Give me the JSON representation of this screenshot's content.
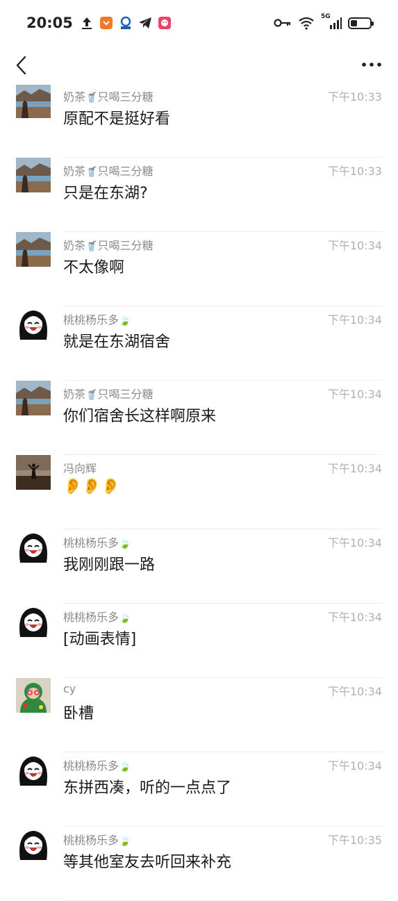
{
  "status": {
    "time": "20:05",
    "network": "5G"
  },
  "battery_level": 0.35,
  "messages": [
    {
      "sender": "奶茶",
      "sender_suffix": "只喝三分糖",
      "suffix_emoji": "🥤",
      "time": "下午10:33",
      "text": "原配不是挺好看",
      "avatar": "landscape"
    },
    {
      "sender": "奶茶",
      "sender_suffix": "只喝三分糖",
      "suffix_emoji": "🥤",
      "time": "下午10:33",
      "text": "只是在东湖?",
      "avatar": "landscape"
    },
    {
      "sender": "奶茶",
      "sender_suffix": "只喝三分糖",
      "suffix_emoji": "🥤",
      "time": "下午10:34",
      "text": "不太像啊",
      "avatar": "landscape"
    },
    {
      "sender": "桃桃杨乐多",
      "sender_suffix": "",
      "suffix_emoji": "🍃",
      "time": "下午10:34",
      "text": "就是在东湖宿舍",
      "avatar": "cartoon-girl"
    },
    {
      "sender": "奶茶",
      "sender_suffix": "只喝三分糖",
      "suffix_emoji": "🥤",
      "time": "下午10:34",
      "text": "你们宿舍长这样啊原来",
      "avatar": "landscape"
    },
    {
      "sender": "冯向辉",
      "sender_suffix": "",
      "suffix_emoji": "",
      "time": "下午10:34",
      "text": "👂👂👂",
      "avatar": "beach"
    },
    {
      "sender": "桃桃杨乐多",
      "sender_suffix": "",
      "suffix_emoji": "🍃",
      "time": "下午10:34",
      "text": "我刚刚跟一路",
      "avatar": "cartoon-girl"
    },
    {
      "sender": "桃桃杨乐多",
      "sender_suffix": "",
      "suffix_emoji": "🍃",
      "time": "下午10:34",
      "text": "[动画表情]",
      "avatar": "cartoon-girl"
    },
    {
      "sender": "cy",
      "sender_suffix": "",
      "suffix_emoji": "",
      "time": "下午10:34",
      "text": "卧槽",
      "avatar": "green-character"
    },
    {
      "sender": "桃桃杨乐多",
      "sender_suffix": "",
      "suffix_emoji": "🍃",
      "time": "下午10:34",
      "text": "东拼西凑，听的一点点了",
      "avatar": "cartoon-girl"
    },
    {
      "sender": "桃桃杨乐多",
      "sender_suffix": "",
      "suffix_emoji": "🍃",
      "time": "下午10:35",
      "text": "等其他室友去听回来补充",
      "avatar": "cartoon-girl"
    }
  ]
}
